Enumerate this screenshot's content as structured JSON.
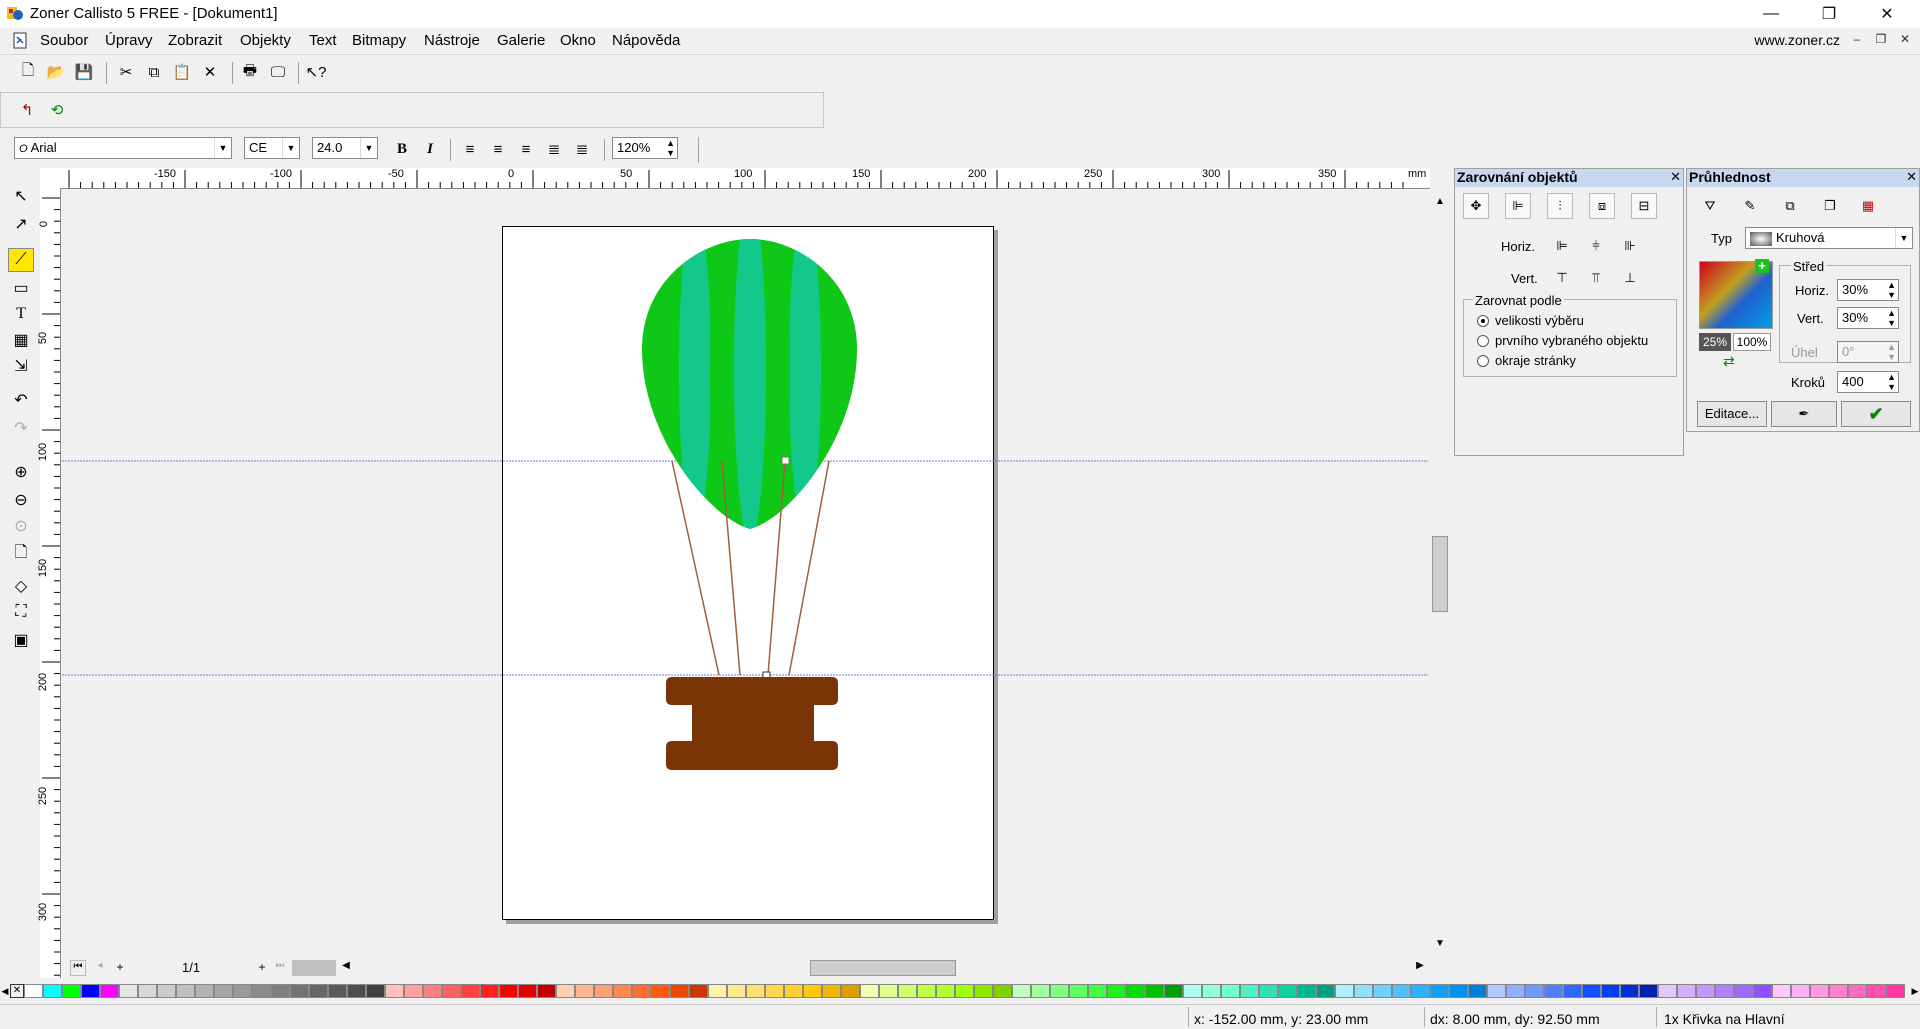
{
  "window": {
    "title": "Zoner Callisto 5 FREE - [Dokument1]",
    "minimize": "—",
    "maximize": "❐",
    "close": "✕"
  },
  "menu": {
    "items": [
      "Soubor",
      "Úpravy",
      "Zobrazit",
      "Objekty",
      "Text",
      "Bitmapy",
      "Nástroje",
      "Galerie",
      "Okno",
      "Nápověda"
    ],
    "site_link": "www.zoner.cz"
  },
  "toolbar": {
    "font_name": "Arial",
    "charset": "CE",
    "font_size": "24.0",
    "bold_label": "B",
    "italic_label": "I",
    "zoom": "120%"
  },
  "ruler": {
    "unit": "mm",
    "h_ticks": [
      "-150",
      "-100",
      "-50",
      "0",
      "50",
      "100",
      "150",
      "200",
      "250",
      "300",
      "350"
    ],
    "v_ticks": [
      "0",
      "50",
      "100",
      "150",
      "200",
      "250",
      "300"
    ]
  },
  "page_nav": {
    "page": "1/1"
  },
  "align_panel": {
    "title": "Zarovnání objektů",
    "horiz_label": "Horiz.",
    "vert_label": "Vert.",
    "group_label": "Zarovnat podle",
    "options": [
      "velikosti výběru",
      "prvního vybraného objektu",
      "okraje stránky"
    ],
    "selected": "velikosti výběru"
  },
  "transparency_panel": {
    "title": "Průhlednost",
    "type_label": "Typ",
    "type_value": "Kruhová",
    "center_label": "Střed",
    "horiz_label": "Horiz.",
    "horiz_value": "30%",
    "vert_label": "Vert.",
    "vert_value": "30%",
    "angle_label": "Úhel",
    "angle_value": "0°",
    "steps_label": "Kroků",
    "steps_value": "400",
    "start_opacity": "25%",
    "end_opacity": "100%",
    "edit_button": "Editace..."
  },
  "status": {
    "coords": "x: -152.00 mm, y: 23.00 mm",
    "delta": "dx: 8.00 mm, dy: 92.50 mm",
    "selection": "1x Křivka na Hlavní"
  },
  "colors": {
    "balloon_green": "#0fc716",
    "balloon_stripe": "#13c98a",
    "basket_brown": "#7a3506",
    "rope": "#a0603a",
    "guide": "#6a78e0"
  },
  "palette": [
    "#ffffff",
    "#00ffff",
    "#00ff00",
    "#0000ff",
    "#ff00ff",
    "#e6e6e6",
    "#d8d8d8",
    "#cccccc",
    "#bfbfbf",
    "#b3b3b3",
    "#a6a6a6",
    "#999999",
    "#8c8c8c",
    "#808080",
    "#737373",
    "#666666",
    "#595959",
    "#4d4d4d",
    "#404040",
    "#ffc0c0",
    "#ffa0a0",
    "#ff8080",
    "#ff6060",
    "#ff4040",
    "#ff2020",
    "#ff0000",
    "#e00000",
    "#c00000",
    "#ffd0b0",
    "#ffb890",
    "#ffa070",
    "#ff8850",
    "#ff7030",
    "#ff5810",
    "#e84800",
    "#c83800",
    "#fff0b0",
    "#ffe890",
    "#ffe070",
    "#ffd850",
    "#ffd030",
    "#ffc810",
    "#f0b800",
    "#d8a000",
    "#f0ffb0",
    "#e0ff90",
    "#d0ff70",
    "#c0ff50",
    "#b0ff30",
    "#a0ff10",
    "#90e800",
    "#80d000",
    "#c0ffc0",
    "#a0ffa0",
    "#80ff80",
    "#60ff60",
    "#40ff40",
    "#20f020",
    "#00e000",
    "#00c000",
    "#00a000",
    "#b0fff0",
    "#90ffe0",
    "#70ffd0",
    "#50f0c0",
    "#30e0b0",
    "#10d0a0",
    "#00b890",
    "#00a080",
    "#b0f0ff",
    "#90e0ff",
    "#70d0ff",
    "#50c0ff",
    "#30b0ff",
    "#10a0ff",
    "#0090f0",
    "#0080d8",
    "#b0c8ff",
    "#90b0ff",
    "#7098ff",
    "#5080ff",
    "#3068ff",
    "#1050ff",
    "#0040f0",
    "#0030d0",
    "#0020b0",
    "#e0c8ff",
    "#d0b0ff",
    "#c098ff",
    "#b080ff",
    "#a068ff",
    "#9050ff",
    "#ffc8ff",
    "#ffb0f0",
    "#ff98e0",
    "#ff80d0",
    "#ff68c0",
    "#ff50b0",
    "#ff38a0"
  ]
}
